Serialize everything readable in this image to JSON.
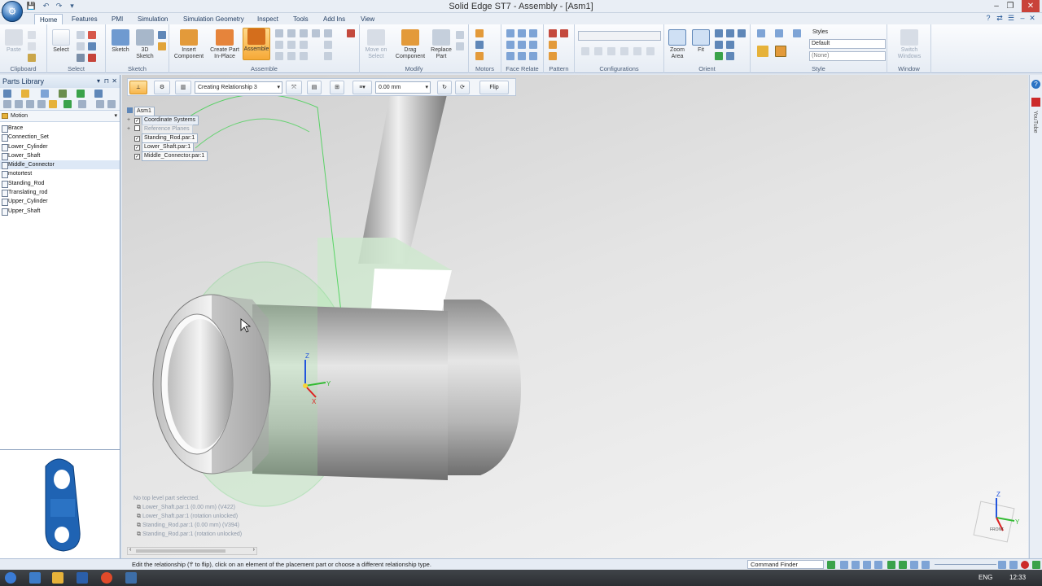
{
  "window": {
    "title": "Solid Edge ST7 - Assembly - [Asm1]"
  },
  "tabs": [
    "Home",
    "Features",
    "PMI",
    "Simulation",
    "Simulation Geometry",
    "Inspect",
    "Tools",
    "Add Ins",
    "View"
  ],
  "ribbon": {
    "clipboard": {
      "label": "Clipboard",
      "paste": "Paste"
    },
    "select": {
      "label": "Select",
      "select": "Select"
    },
    "sketch": {
      "label": "Sketch",
      "sketch": "Sketch",
      "sketch3d": "3D\nSketch"
    },
    "assemble": {
      "label": "Assemble",
      "insert": "Insert\nComponent",
      "create_in_place": "Create Part\nIn-Place",
      "assemble": "Assemble"
    },
    "modify": {
      "label": "Modify",
      "move": "Move on\nSelect",
      "drag": "Drag\nComponent",
      "replace": "Replace\nPart"
    },
    "motors": {
      "label": "Motors"
    },
    "face_relate": {
      "label": "Face Relate"
    },
    "pattern": {
      "label": "Pattern"
    },
    "configurations": {
      "label": "Configurations"
    },
    "orient": {
      "label": "Orient",
      "zoom_area": "Zoom\nArea",
      "fit": "Fit"
    },
    "style": {
      "label": "Style",
      "styles": "Styles",
      "default": "Default",
      "none": "(None)"
    },
    "window": {
      "label": "Window",
      "switch": "Switch\nWindows"
    }
  },
  "parts_library": {
    "title": "Parts Library",
    "location": "Motion",
    "items": [
      "Brace",
      "Connection_Set",
      "Lower_Cylinder",
      "Lower_Shaft",
      "Middle_Connector",
      "motortest",
      "Standing_Rod",
      "Translating_rod",
      "Upper_Cylinder",
      "Upper_Shaft"
    ]
  },
  "command_bar": {
    "relationship": "Creating Relationship 3",
    "offset": "0.00 mm",
    "flip": "Flip"
  },
  "tree": {
    "root": "Asm1",
    "items": [
      {
        "label": "Coordinate Systems",
        "checked": true
      },
      {
        "label": "Reference Planes",
        "checked": false
      },
      {
        "label": "Standing_Rod.par:1",
        "checked": true
      },
      {
        "label": "Lower_Shaft.par:1",
        "checked": true
      },
      {
        "label": "Middle_Connector.par:1",
        "checked": true
      }
    ]
  },
  "relationships": {
    "header": "No top level part selected.",
    "rows": [
      "Lower_Shaft.par:1  (0.00 mm)  (V422)",
      "Lower_Shaft.par:1  (rotation unlocked)",
      "Standing_Rod.par:1  (0.00 mm)  (V394)",
      "Standing_Rod.par:1  (rotation unlocked)"
    ]
  },
  "triad": {
    "z": "Z",
    "x": "X",
    "y": "Y"
  },
  "cube_triad": {
    "z": "Z",
    "y": "Y",
    "front": "FRONT"
  },
  "status": {
    "prompt": "Edit the relationship ('f' to flip), click on an element of the placement part or choose a different relationship type.",
    "command_finder": "Command Finder"
  },
  "right_strip": {
    "label": "YouTube"
  },
  "taskbar": {
    "lang": "ENG",
    "time": "12:33"
  },
  "colors": {
    "accent": "#f6a937",
    "selection_green": "#3ad14a",
    "ribbon_text": "#1f3a5f"
  }
}
